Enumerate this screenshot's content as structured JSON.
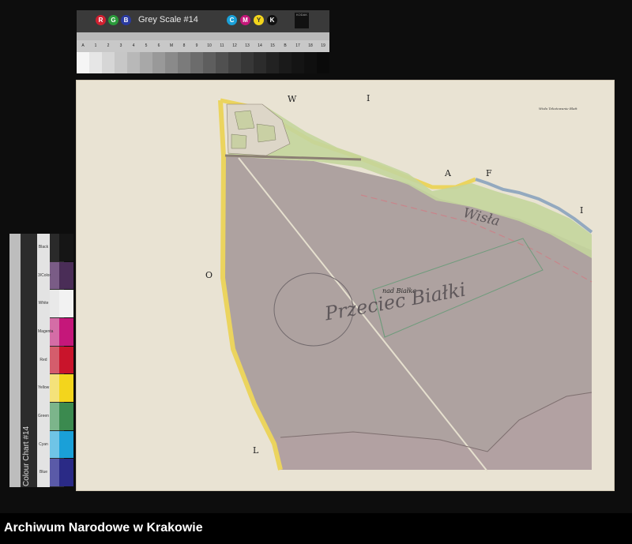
{
  "greyscale_chart": {
    "title": "Grey Scale #14",
    "rgb_letters": [
      "R",
      "G",
      "B"
    ],
    "cmyk_letters": [
      "C",
      "M",
      "Y",
      "K"
    ],
    "ruler_labels": [
      "A",
      "1",
      "2",
      "3",
      "4",
      "5",
      "6",
      "M",
      "8",
      "9",
      "10",
      "11",
      "12",
      "13",
      "14",
      "15",
      "B",
      "17",
      "18",
      "19"
    ],
    "logo_text": "KODAK",
    "steps": [
      "#f5f5f5",
      "#e6e6e6",
      "#d6d6d6",
      "#c7c7c7",
      "#b8b8b8",
      "#a8a8a8",
      "#999999",
      "#8a8a8a",
      "#7b7b7b",
      "#6c6c6c",
      "#5e5e5e",
      "#505050",
      "#434343",
      "#373737",
      "#2c2c2c",
      "#222222",
      "#1a1a1a",
      "#141414",
      "#0f0f0f",
      "#0a0a0a"
    ]
  },
  "colour_chart": {
    "title": "Colour Chart #14",
    "labels": [
      "Black",
      "3/Color",
      "White",
      "Magenta",
      "Red",
      "Yellow",
      "Green",
      "Cyan",
      "Blue"
    ],
    "swatches": [
      "#151515",
      "#4a2d57",
      "#f2f2f2",
      "#c5177a",
      "#c9142b",
      "#f3d51c",
      "#3b8a4f",
      "#1aa0d8",
      "#2a2a86"
    ],
    "swatches2": [
      "#2a2a2a",
      "#7a5c86",
      "#e9e9e9",
      "#d46da6",
      "#d45d6c",
      "#f4e27a",
      "#7cb58b",
      "#6fc4e6",
      "#5a5aa8"
    ]
  },
  "map": {
    "letters": [
      "W",
      "I",
      "A",
      "F",
      "I",
      "O",
      "L"
    ],
    "place_name": "nad Białką",
    "handwriting": [
      "Przeciec Białki",
      "Wisła"
    ],
    "small_notes": [
      "Wisła Tekstowanie Blatt"
    ],
    "colors": {
      "paper": "#e9e3d3",
      "pasture": "#ddd6c8",
      "meadow": "#c4d59c",
      "riverbed": "#a39696",
      "border_yellow": "#ebd45e",
      "river_blue": "#93a9bf",
      "road_red": "#c9848a"
    }
  },
  "footer": {
    "label": "Archiwum Narodowe w Krakowie"
  }
}
